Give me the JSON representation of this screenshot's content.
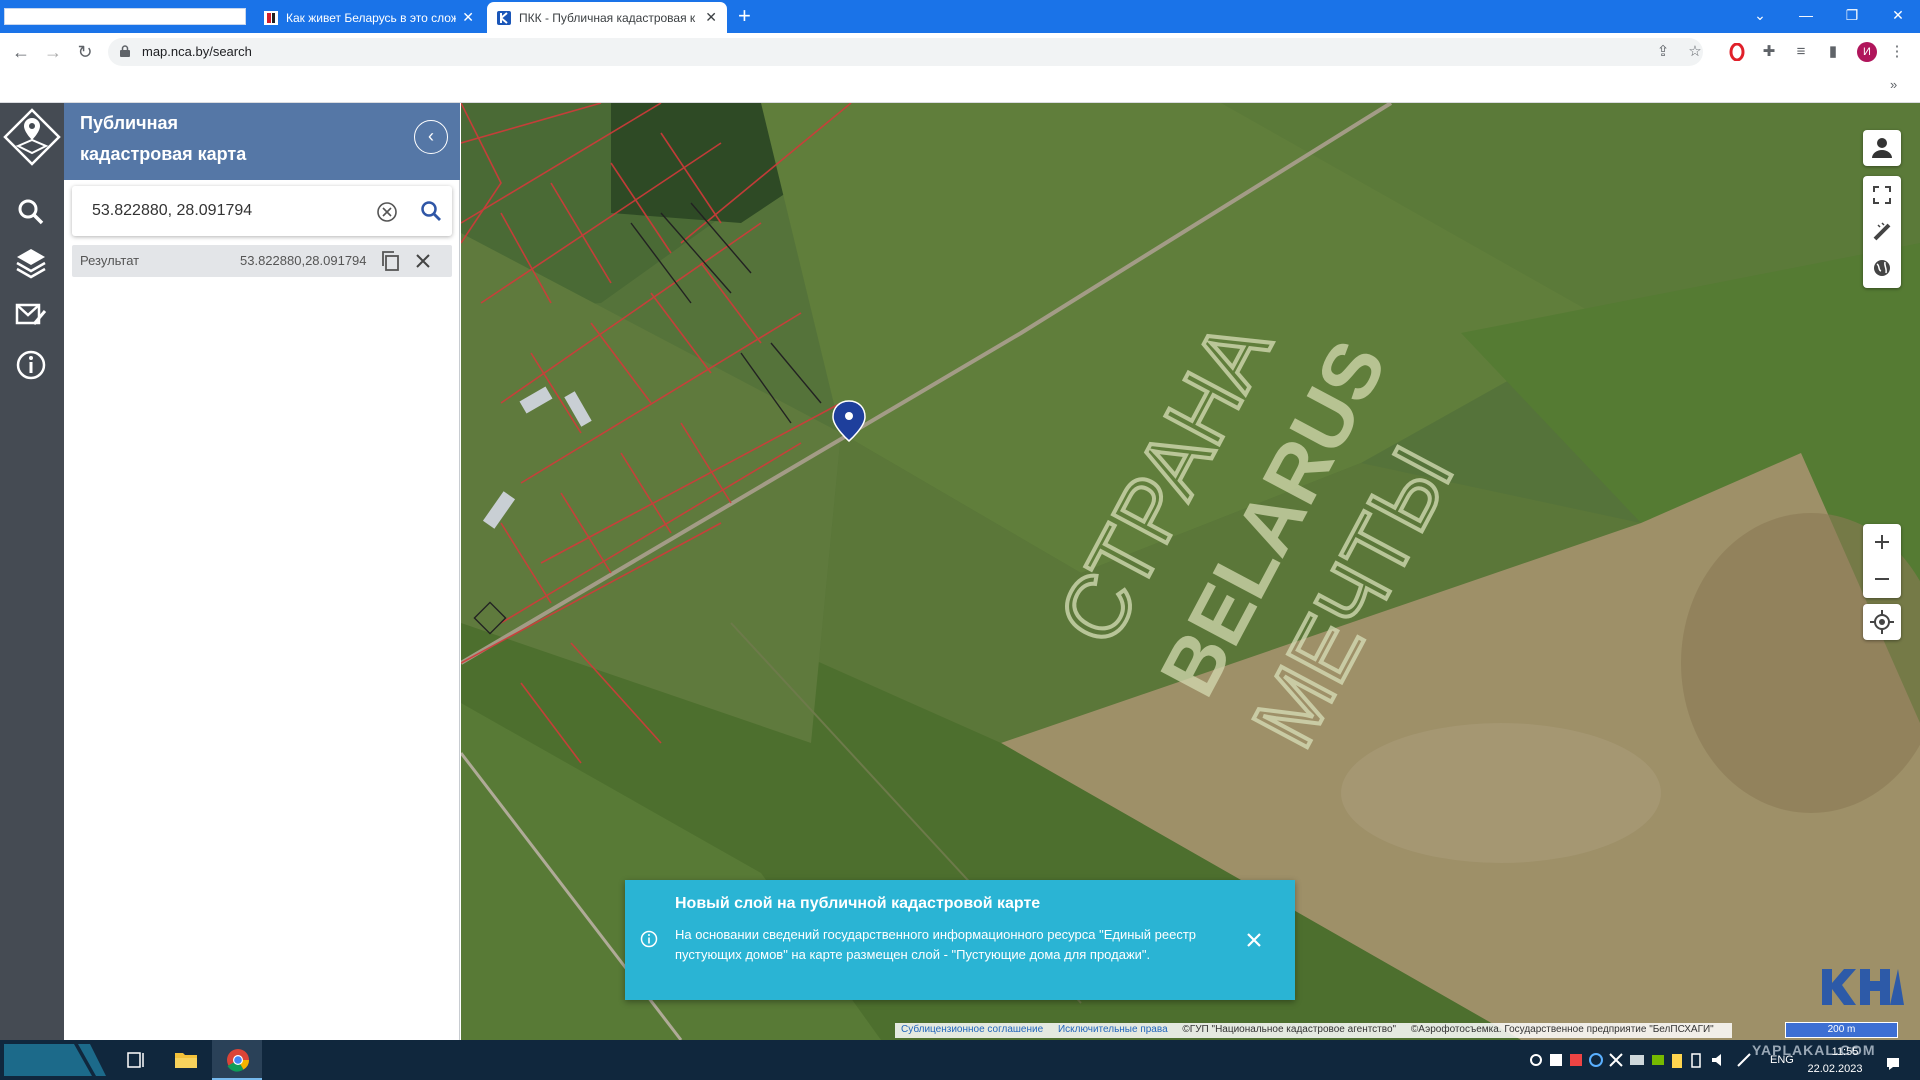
{
  "browser": {
    "tabs": [
      {
        "title": "Как живет Беларусь в это слож"
      },
      {
        "title": "ПКК - Публичная кадастровая к"
      }
    ],
    "url": "map.nca.by/search",
    "profile_initial": "И"
  },
  "app": {
    "title_line1": "Публичная",
    "title_line2": "кадастровая карта",
    "search": {
      "value": "53.822880, 28.091794"
    },
    "result": {
      "label": "Результат",
      "value": "53.822880,28.091794"
    },
    "accent": "#5577a6"
  },
  "map": {
    "field_text_1": "СТРАНА",
    "field_text_2": "BELARUS",
    "field_text_3": "МЕЧТЫ",
    "scale": "200 m",
    "attribution": {
      "sublicense": "Сублицензионное соглашение",
      "rights": "Исключительные права",
      "owner": "©ГУП \"Национальное кадастровое агентство\"",
      "aerial": "©Аэрофотосъемка. Государственное предприятие \"БелПСХАГИ\""
    }
  },
  "toast": {
    "title": "Новый слой на публичной кадастровой карте",
    "body": "На основании сведений государственного информационного ресурса \"Единый реестр пустующих домов\" на карте размещен слой - \"Пустующие дома для продажи\".",
    "color": "#2ab4d4"
  },
  "taskbar": {
    "lang": "ENG",
    "time": "11:55",
    "date": "22.02.2023",
    "watermark": "YAPLAKAL.COM"
  }
}
